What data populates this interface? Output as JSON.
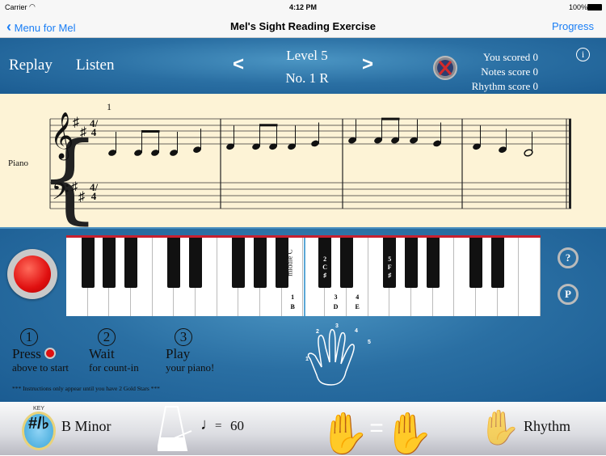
{
  "status_bar": {
    "carrier": "Carrier",
    "time": "4:12 PM",
    "battery": "100%"
  },
  "nav": {
    "back_label": "Menu for Mel",
    "title": "Mel's Sight Reading Exercise",
    "progress_label": "Progress"
  },
  "header": {
    "replay": "Replay",
    "listen": "Listen",
    "prev": "<",
    "next": ">",
    "level": "Level 5",
    "number": "No. 1 R",
    "scores": {
      "total": "You scored 0",
      "notes": "Notes score 0",
      "rhythm": "Rhythm score 0"
    },
    "info": "i"
  },
  "score": {
    "instrument": "Piano",
    "measure_number": "1",
    "time_signature": "4/4",
    "key": "B Minor",
    "notes": [
      [
        [
          "B",
          "q"
        ],
        [
          "B",
          "e"
        ],
        [
          "B",
          "e"
        ],
        [
          "B",
          "q"
        ],
        [
          "C#",
          "q"
        ]
      ],
      [
        [
          "D",
          "q"
        ],
        [
          "D",
          "e"
        ],
        [
          "D",
          "e"
        ],
        [
          "D",
          "q"
        ],
        [
          "E",
          "q"
        ]
      ],
      [
        [
          "F#",
          "q"
        ],
        [
          "F#",
          "e"
        ],
        [
          "F#",
          "e"
        ],
        [
          "F#",
          "q"
        ],
        [
          "E",
          "q"
        ]
      ],
      [
        [
          "D",
          "q"
        ],
        [
          "C#",
          "q"
        ],
        [
          "B",
          "h"
        ]
      ]
    ]
  },
  "keyboard": {
    "middle_c_label": "middle C",
    "white_keys": [
      "F",
      "G",
      "A",
      "B",
      "C",
      "D",
      "E",
      "F",
      "G",
      "A",
      "B",
      "C",
      "D",
      "E",
      "F",
      "G",
      "A",
      "B",
      "C",
      "D",
      "E",
      "F"
    ],
    "finger_labels": [
      {
        "finger": "1",
        "note": "B"
      },
      {
        "finger": "2",
        "note": "C",
        "accidental": "♯"
      },
      {
        "finger": "3",
        "note": "D"
      },
      {
        "finger": "4",
        "note": "E"
      },
      {
        "finger": "5",
        "note": "F",
        "accidental": "♯"
      }
    ],
    "help_button": "?",
    "p_button": "P",
    "highlight_color": "#c8202f"
  },
  "instructions": {
    "steps": [
      {
        "n": "1",
        "title": "Press",
        "sub": "above to start"
      },
      {
        "n": "2",
        "title": "Wait",
        "sub": "for count-in"
      },
      {
        "n": "3",
        "title": "Play",
        "sub": "your piano!"
      }
    ],
    "note": "*** Instructions only appear until you have 2 Gold Stars ***"
  },
  "hand": {
    "fingers": [
      "1",
      "2",
      "3",
      "4",
      "5"
    ]
  },
  "bottom": {
    "key_badge": "KEY",
    "key_name": "B Minor",
    "tempo_equals": "=",
    "tempo": "60",
    "rhythm": "Rhythm"
  }
}
